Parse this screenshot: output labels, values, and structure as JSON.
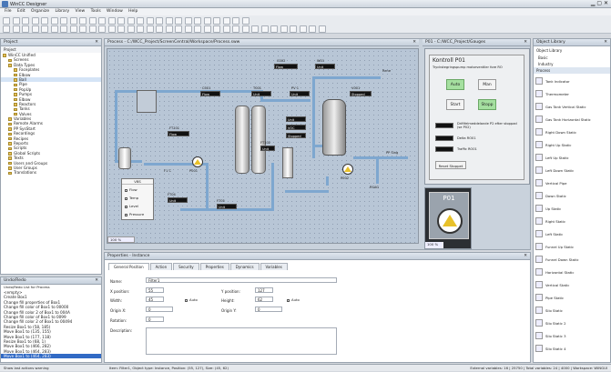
{
  "app": {
    "title": "WinCC Designer"
  },
  "menu": [
    "File",
    "Edit",
    "Organize",
    "Library",
    "View",
    "Tools",
    "Window",
    "Help"
  ],
  "project": {
    "header": "Project",
    "subheader": "Project",
    "tree": [
      "WinCC Unified",
      "Screens",
      "Data Types",
      "Faceplates",
      "Elbow",
      "Ball",
      "Pipe",
      "PopUp",
      "Pumps",
      "Elbow",
      "Reactors",
      "Tanks",
      "Valves",
      "Variables",
      "Remote Alarms",
      "PP SysStart",
      "Recordings",
      "Recipes",
      "Reports",
      "Scripts",
      "Global Scripts",
      "Texts",
      "Users and Groups",
      "User Groups",
      "Translations"
    ]
  },
  "undo": {
    "header": "Undo/Redo",
    "subheader": "Undo/Redo List for Process",
    "items": [
      "<empty>",
      "Create Box1",
      "Change fill properties of Box1",
      "Change fill color of Box1 to 00000",
      "Change fill color 2 of Box1 to 004A",
      "Change fill color of Box1 to 0099",
      "Change fill color 2 of Box1 to 00494",
      "Resize Box1 to (58, 185)",
      "Move Box1 to (135, 155)",
      "Move Box1 to (177, 118)",
      "Resize Box1 to (68, 1)",
      "Move Box1 to (466, 282)",
      "Move Box1 to (464, 283)",
      "Move Box1 to (464, 283)"
    ]
  },
  "editor": {
    "tab1": "Process - C:/WCC_Project/ScreenCentral/Workspace/Process.sww",
    "tab2": "P01 - C:/WCC_Project/Gauges",
    "zoom": "100 %",
    "zoom2": "100 %",
    "labels": {
      "c002": "C002",
      "w01": "W01",
      "rene": "Rene",
      "flow1": "Flow",
      "c001": "C001",
      "t001": "T001",
      "pv1": "PV 1",
      "p001": "P001",
      "p002": "P002",
      "f1c": "F1 C",
      "v001": "V001",
      "ft101": "FT101",
      "ft102": "FT102",
      "rsag": "RSAG",
      "pp": "PP Sing",
      "unit": "Unit",
      "voc": "VOC",
      "stopped": "Stopped",
      "stopped2": "Stopped",
      "flow2": "Flow",
      "flow3": "Flow",
      "ft04": "FT04",
      "ft05": "FT05"
    },
    "legend": {
      "title": "VBS",
      "items": [
        "Flow",
        "Temp",
        "Level",
        "Pressure"
      ]
    },
    "kontrol": {
      "title": "Kontroll P01",
      "sub": "Tryckstegringspump motorventiler fore RO",
      "auto": "Auto",
      "man": "Man",
      "start": "Start",
      "stopp": "Stopp",
      "rows": [
        "Stoppad",
        "Driftfelmeddelande P2 efter stoppad (se P02)",
        "Delta RO01",
        "Traffic RO01"
      ],
      "reset": "Reset Stoppet"
    },
    "gauge": {
      "title": "P01",
      "zoom": "100 %"
    }
  },
  "library": {
    "header": "Object Library",
    "tab": "Object Library",
    "groups": [
      "Basic",
      "Industry"
    ],
    "sub": "Process",
    "items": [
      "Tank Indicator",
      "Thermometer",
      "Gas Tank Vertical Static",
      "Gas Tank Horizontal Static",
      "Right Down Static",
      "Right Up Static",
      "Left Up Static",
      "Left Down Static",
      "Vertical Pipe",
      "Down Static",
      "Up Static",
      "Right Static",
      "Left Static",
      "Funnel Up Static",
      "Funnel Down Static",
      "Horizontal Static",
      "Vertical Static",
      "Pipe Static",
      "Silo Static",
      "Silo Static 2",
      "Silo Static 3",
      "Silo Static 4"
    ]
  },
  "properties": {
    "header": "Properties - Instance",
    "tabs": [
      "General Position",
      "Action",
      "Security",
      "Properties",
      "Dynamics",
      "Variables"
    ],
    "name_label": "Name:",
    "name_val": "Filter1",
    "xpos_label": "X position:",
    "xpos_val": "55",
    "ypos_label": "Y position:",
    "ypos_val": "127",
    "width_label": "Width:",
    "width_val": "45",
    "height_label": "Height:",
    "height_val": "62",
    "auto": "Auto",
    "auto2": "Auto",
    "origin_x": "Origin X:",
    "origin_y": "Origin Y:",
    "origin_x_val": "0",
    "origin_y_val": "0",
    "rotation": "Rotation:",
    "rotation_val": "0",
    "description": "Description:"
  },
  "status": {
    "left": "Show last actions warning",
    "mid": "Item: Filter1, Object type: Instance, Position: (55, 127), Size: (45, 62)",
    "right": "External variables: 16 | 25750 | Total variables: 24 | 4000 | Workspace: WINGUI"
  }
}
